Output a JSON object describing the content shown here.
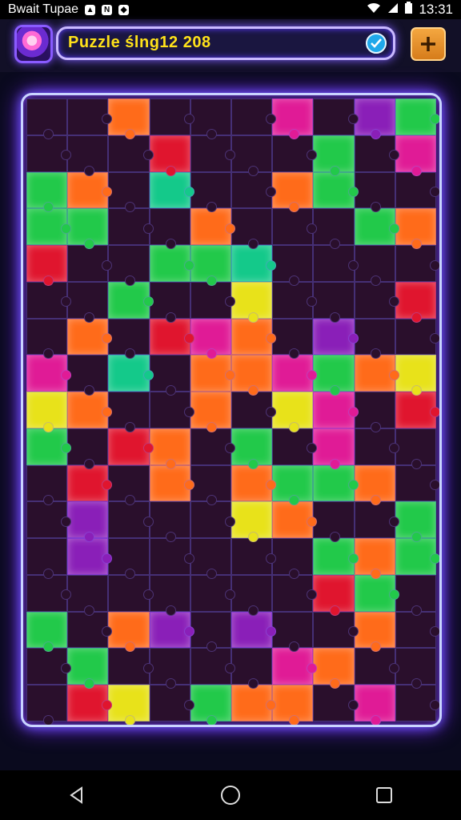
{
  "status_bar": {
    "left_text": "Bwait Tupae",
    "time": "13:31",
    "icons": [
      "notification-icon",
      "n-icon",
      "shield-icon",
      "wifi-icon",
      "signal-icon",
      "battery-icon"
    ]
  },
  "header": {
    "title": "Puzzle ślng12 208",
    "avatar_icon": "character-avatar",
    "verified_icon": "check-icon",
    "add_icon": "plus-icon"
  },
  "board": {
    "columns": 10,
    "rows": 17,
    "colors": {
      "G": "#22c94a",
      "O": "#ff6b1a",
      "M": "#e01b96",
      "P": "#8a1fb8",
      "D": "#2a0f2c",
      "R": "#e0152e",
      "Y": "#e8e21a",
      "T": "#14c98a",
      "N": "#0a1a22"
    },
    "layout": [
      "DDODDDMDPG",
      "DDDRDDDGDM",
      "GODTDDOGDD",
      "GGDDODDDGO",
      "RDDGGTDDDD",
      "DDGDDYDDDR",
      "DODRMODPDD",
      "MDTDOOMGOY",
      "YODDODYMDR",
      "GDRODGDMDD",
      "DRDODOGGOD",
      "DPDDDYODDG",
      "DPDDDDDGOG",
      "DDDDDDDRGD",
      "GDOPDPDDOD",
      "DGDDDDMODD",
      "DRYDGOODMD"
    ]
  },
  "nav": {
    "back_icon": "back-icon",
    "home_icon": "home-icon",
    "recents_icon": "recents-icon"
  }
}
